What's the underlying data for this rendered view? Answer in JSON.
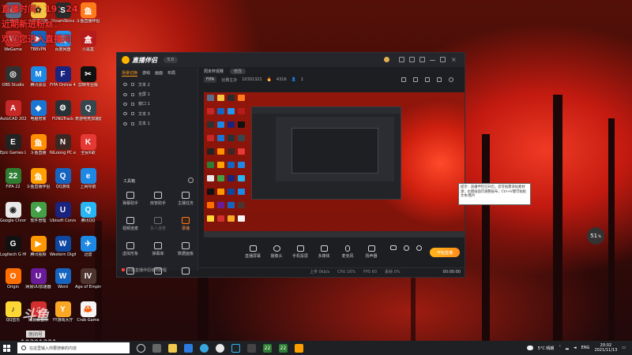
{
  "overlay_lines": [
    "直播时间：19：24",
    "近期新进粉丝：",
    "欢迎您进入直播间"
  ],
  "desktop_icons": [
    {
      "label": "回收站",
      "icon": "recycle-bin-icon",
      "color": "#5b6e8a",
      "glyph": "♻"
    },
    {
      "label": "小鸡模拟器",
      "icon": "chick-emulator-icon",
      "color": "#f5c542",
      "glyph": "✿"
    },
    {
      "label": "SteamSkins",
      "icon": "steamskins-icon",
      "color": "#2b2b2b",
      "glyph": "S"
    },
    {
      "label": "斗鱼直播伴侣",
      "icon": "douyu-icon",
      "color": "#ff7a1a",
      "glyph": "鱼"
    },
    {
      "label": "WeGame",
      "icon": "wegame-icon",
      "color": "#c62828",
      "glyph": "W"
    },
    {
      "label": "TBBVPN",
      "icon": "vpn-icon",
      "color": "#1565c0",
      "glyph": "▶"
    },
    {
      "label": "百度网盘",
      "icon": "baidu-netdisk-icon",
      "color": "#2196f3",
      "glyph": "云"
    },
    {
      "label": "小黑盒",
      "icon": "heybox-icon",
      "color": "#b71c1c",
      "glyph": "盒"
    },
    {
      "label": "OBS Studio",
      "icon": "obs-icon",
      "color": "#303030",
      "glyph": "◎"
    },
    {
      "label": "腾讯会议",
      "icon": "tencent-meeting-icon",
      "color": "#1e88e5",
      "glyph": "M"
    },
    {
      "label": "FIFA Online 4",
      "icon": "fifa-online-icon",
      "color": "#1a237e",
      "glyph": "F"
    },
    {
      "label": "剪映专业版",
      "icon": "capcut-icon",
      "color": "#111111",
      "glyph": "✂"
    },
    {
      "label": "AutoCAD 2020",
      "icon": "autocad-icon",
      "color": "#c62828",
      "glyph": "A"
    },
    {
      "label": "电脑管家",
      "icon": "pc-manager-icon",
      "color": "#1976d2",
      "glyph": "◆"
    },
    {
      "label": "FUNGTrack",
      "icon": "fungtrack-icon",
      "color": "#263238",
      "glyph": "⚙"
    },
    {
      "label": "奇游电竞加速器",
      "icon": "qiyou-accelerator-icon",
      "color": "#37474f",
      "glyph": "Q"
    },
    {
      "label": "Epic Games Launcher",
      "icon": "epic-games-icon",
      "color": "#222222",
      "glyph": "E"
    },
    {
      "label": "斗鱼直播",
      "icon": "douyu-live-icon",
      "color": "#ff8f00",
      "glyph": "鱼"
    },
    {
      "label": "NiLoong PC.exe",
      "icon": "niloong-icon",
      "color": "#3e2723",
      "glyph": "N"
    },
    {
      "label": "全民K歌",
      "icon": "kge-icon",
      "color": "#e53935",
      "glyph": "K"
    },
    {
      "label": "FIFA 22",
      "icon": "fifa22-icon",
      "color": "#2e7d32",
      "glyph": "22"
    },
    {
      "label": "斗鱼直播伴侣",
      "icon": "douyu-companion-icon",
      "color": "#ffa000",
      "glyph": "鱼"
    },
    {
      "label": "QQ游戏",
      "icon": "qq-game-icon",
      "color": "#1565c0",
      "glyph": "Q"
    },
    {
      "label": "上网导航",
      "icon": "ie-icon",
      "color": "#1e88e5",
      "glyph": "e"
    },
    {
      "label": "Google Chrome",
      "icon": "chrome-icon",
      "color": "#e8e8e8",
      "glyph": "◉"
    },
    {
      "label": "软件管理",
      "icon": "software-manager-icon",
      "color": "#43a047",
      "glyph": "❖"
    },
    {
      "label": "Ubisoft Connect",
      "icon": "ubisoft-icon",
      "color": "#1a237e",
      "glyph": "U"
    },
    {
      "label": "腾讯QQ",
      "icon": "qq-icon",
      "color": "#29b6f6",
      "glyph": "Q"
    },
    {
      "label": "Logitech G HUB",
      "icon": "ghub-icon",
      "color": "#111111",
      "glyph": "G"
    },
    {
      "label": "腾讯视频",
      "icon": "tencent-video-icon",
      "color": "#ff9800",
      "glyph": "▶"
    },
    {
      "label": "Western Digital",
      "icon": "wd-icon",
      "color": "#0d47a1",
      "glyph": "W"
    },
    {
      "label": "迅雷",
      "icon": "xunlei-icon",
      "color": "#1e88e5",
      "glyph": "✈"
    },
    {
      "label": "Origin",
      "icon": "origin-icon",
      "color": "#ff6f00",
      "glyph": "O"
    },
    {
      "label": "网易UU加速器",
      "icon": "uu-accelerator-icon",
      "color": "#6a1b9a",
      "glyph": "U"
    },
    {
      "label": "Word",
      "icon": "word-icon",
      "color": "#1565c0",
      "glyph": "W"
    },
    {
      "label": "Age of Empires IV",
      "icon": "aoe-icon",
      "color": "#4e342e",
      "glyph": "IV"
    },
    {
      "label": "QQ音乐",
      "icon": "qq-music-icon",
      "color": "#fdd835",
      "glyph": "♪"
    },
    {
      "label": "网易云音乐",
      "icon": "netease-music-icon",
      "color": "#d32f2f",
      "glyph": "♫"
    },
    {
      "label": "YY游戏大厅",
      "icon": "yy-icon",
      "color": "#f9a825",
      "glyph": "Y"
    },
    {
      "label": "Crab Game",
      "icon": "crab-game-icon",
      "color": "#f5f5f5",
      "glyph": "🦀"
    }
  ],
  "studio": {
    "logo": "直播伴侣",
    "version": "5.0",
    "left_tabs": [
      "场景切换",
      "游戏",
      "画面",
      "布局"
    ],
    "scenes": [
      "文本 2",
      "全屏 1",
      "窗口 1",
      "文本 3",
      "文本 1"
    ],
    "tools_title": "工具箱",
    "tools": [
      "弹幕助手",
      "房管助手",
      "主播任务",
      "视频连麦",
      "多人连麦",
      "录播",
      "虚拟形象",
      "弹幕库",
      "数据面板",
      "",
      "",
      ""
    ],
    "banner": "斗鱼直播伴侣使用教程",
    "scene_name": "周末杯观赛",
    "scene_btn": "修改",
    "room_tag": "FIFA",
    "room_sub": "比赛主办",
    "room_id": "10301321",
    "heat": "4316",
    "fans": "1",
    "controls": [
      "直播屏幕",
      "摄像头",
      "手机投屏",
      "多媒体",
      "麦克风",
      "扬声器"
    ],
    "go_live": "开始直播",
    "status": [
      "上传 0kb/s",
      "CPU 16%",
      "FPS 60",
      "丢帧 0%"
    ],
    "live_timer": "00:00:00"
  },
  "balloon_text": "提示：直播伴侣已开启，您可按需添加素材源；右键画面可调整画布；Ctrl+V键可粘贴文本/图片",
  "bubble_value": "51",
  "bubble_unit": "%",
  "watermark": {
    "logo": "斗鱼",
    "box": "房间号",
    "number": "10301321"
  },
  "taskbar": {
    "search_placeholder": "在这里输入你要搜索的内容",
    "weather": "5°C 晴朗",
    "lang": "ENG",
    "time": "20:02",
    "date": "2021/11/13"
  }
}
